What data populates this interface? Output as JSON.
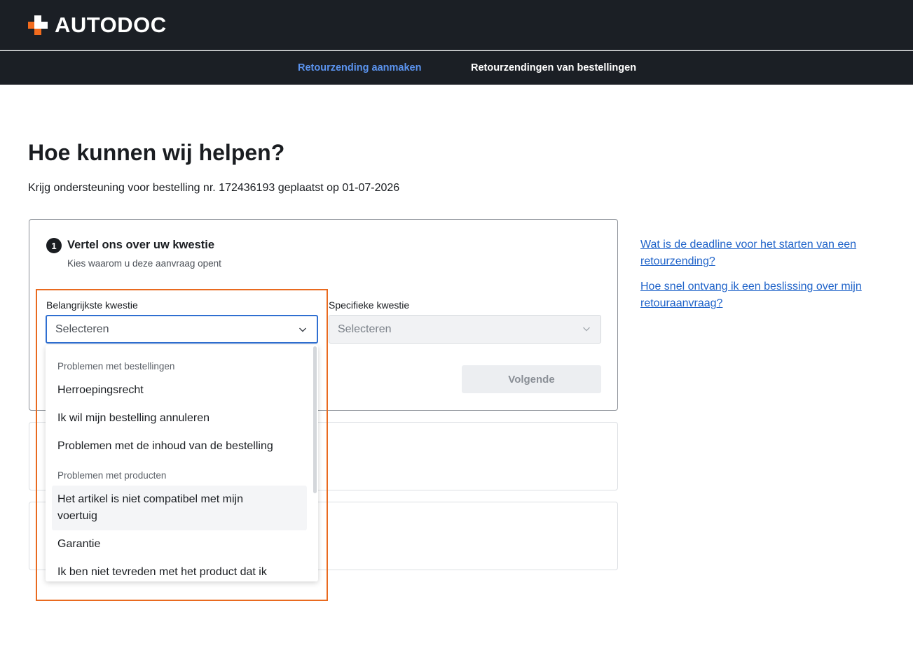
{
  "brand": {
    "name": "AUTODOC",
    "accent": "#f26b1d",
    "header_bg": "#1b1f25",
    "link_color": "#1f63c9"
  },
  "nav": {
    "create_return": "Retourzending aanmaken",
    "order_returns": "Retourzendingen van bestellingen"
  },
  "page": {
    "title": "Hoe kunnen wij helpen?",
    "subtitle": "Krijg ondersteuning voor bestelling nr. 172436193 geplaatst op 01-07-2026"
  },
  "step1": {
    "number": "1",
    "title": "Vertel ons over uw kwestie",
    "subtitle": "Kies waarom u deze aanvraag opent",
    "main_issue_label": "Belangrijkste kwestie",
    "main_issue_value": "Selecteren",
    "specific_issue_label": "Specifieke kwestie",
    "specific_issue_value": "Selecteren",
    "next_button": "Volgende"
  },
  "dropdown": {
    "groups": [
      {
        "label": "Problemen met bestellingen",
        "items": [
          "Herroepingsrecht",
          "Ik wil mijn bestelling annuleren",
          "Problemen met de inhoud van de bestelling"
        ]
      },
      {
        "label": "Problemen met producten",
        "items": [
          "Het artikel is niet compatibel met mijn voertuig",
          "Garantie",
          "Ik ben niet tevreden met het product dat ik"
        ]
      }
    ]
  },
  "help_links": [
    "Wat is de deadline voor het starten van een retourzending?",
    "Hoe snel ontvang ik een beslissing over mijn retouraanvraag?"
  ]
}
